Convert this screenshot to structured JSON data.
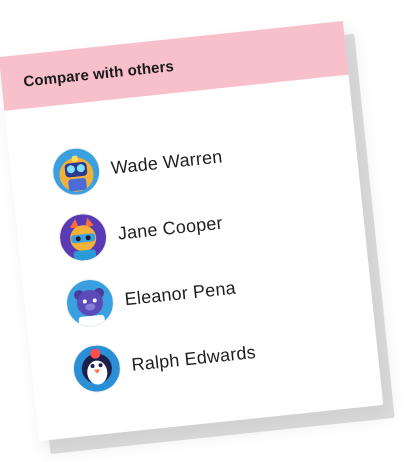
{
  "card": {
    "title": "Compare with others",
    "header_color": "#f8c0cb"
  },
  "users": [
    {
      "name": "Wade Warren",
      "avatar_icon": "robot-avatar-icon"
    },
    {
      "name": "Jane Cooper",
      "avatar_icon": "cat-avatar-icon"
    },
    {
      "name": "Eleanor Pena",
      "avatar_icon": "bear-avatar-icon"
    },
    {
      "name": "Ralph Edwards",
      "avatar_icon": "penguin-avatar-icon"
    }
  ]
}
